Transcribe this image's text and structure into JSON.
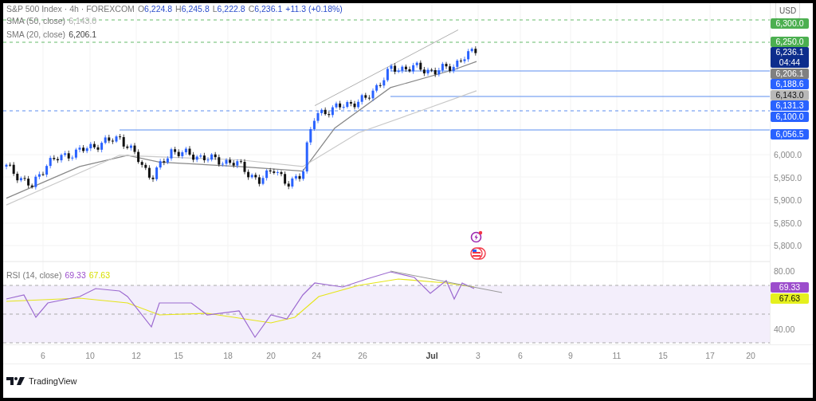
{
  "header": {
    "symbol": "S&P 500 Index · 4h · FOREXCOM",
    "quotes": [
      {
        "label": "O",
        "value": "6,224.8"
      },
      {
        "label": "H",
        "value": "6,245.8"
      },
      {
        "label": "L",
        "value": "6,222.8"
      },
      {
        "label": "C",
        "value": "6,236.1"
      }
    ],
    "change": "+11.3 (+0.18%)"
  },
  "indicators": [
    {
      "name": "SMA (50, close)",
      "value": "6,143.0"
    },
    {
      "name": "SMA (20, close)",
      "value": "6,206.1"
    }
  ],
  "price_axis": {
    "currency": "USD",
    "ticks": [
      "6,000.0",
      "5,950.0",
      "5,900.0",
      "5,850.0",
      "5,800.0"
    ]
  },
  "price_labels": [
    {
      "text": "6,300.0",
      "color": "#4caf50"
    },
    {
      "text": "6,250.0",
      "color": "#4caf50"
    },
    {
      "text": "6,236.1",
      "countdown": "04:44",
      "color": "#0d2d8c"
    },
    {
      "text": "6,206.1",
      "color": "#808080"
    },
    {
      "text": "6,188.6",
      "color": "#2962ff"
    },
    {
      "text": "6,143.0",
      "color": "#b8b8b8"
    },
    {
      "text": "6,131.3",
      "color": "#2962ff"
    },
    {
      "text": "6,100.0",
      "color": "#2962ff"
    },
    {
      "text": "6,056.5",
      "color": "#2962ff"
    }
  ],
  "rsi": {
    "title": "RSI (14, close)",
    "value": "69.33",
    "signal": "67.63",
    "axis_ticks": [
      "80.00",
      "40.00"
    ],
    "labels": [
      {
        "text": "69.33",
        "color": "#9c4dcc"
      },
      {
        "text": "67.63",
        "color": "#e5f01e"
      }
    ]
  },
  "time_axis": [
    {
      "label": "6",
      "kind": "day"
    },
    {
      "label": "10",
      "kind": "day"
    },
    {
      "label": "12",
      "kind": "day"
    },
    {
      "label": "15",
      "kind": "day"
    },
    {
      "label": "18",
      "kind": "day"
    },
    {
      "label": "20",
      "kind": "day"
    },
    {
      "label": "24",
      "kind": "day"
    },
    {
      "label": "26",
      "kind": "day"
    },
    {
      "label": "Jul",
      "kind": "month"
    },
    {
      "label": "3",
      "kind": "day"
    },
    {
      "label": "6",
      "kind": "day"
    },
    {
      "label": "9",
      "kind": "day"
    },
    {
      "label": "11",
      "kind": "day"
    },
    {
      "label": "15",
      "kind": "day"
    },
    {
      "label": "17",
      "kind": "day"
    },
    {
      "label": "20",
      "kind": "day"
    }
  ],
  "footer": {
    "brand": "TradingView"
  }
}
